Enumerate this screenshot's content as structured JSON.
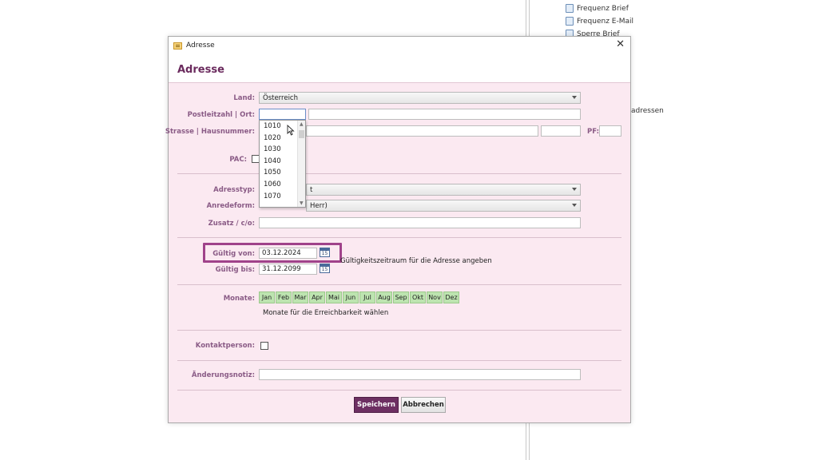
{
  "background": {
    "items": [
      "Frequenz Brief",
      "Frequenz E-Mail",
      "Sperre Brief"
    ],
    "side_text": "adressen"
  },
  "dialog": {
    "window_title": "Adresse",
    "close_glyph": "✕",
    "header_title": "Adresse"
  },
  "form": {
    "land_label": "Land:",
    "land_value": "Österreich",
    "plz_label": "Postleitzahl | Ort:",
    "plz_value": "",
    "ort_value": "",
    "strasse_label": "Strasse | Hausnummer:",
    "pf_label": "PF:",
    "pac_label": "PAC:",
    "adresstyp_label": "Adresstyp:",
    "adresstyp_value": "t",
    "anredeform_label": "Anredeform:",
    "anredeform_value": "Herr)",
    "zusatz_label": "Zusatz / c/o:",
    "gueltig_von_label": "Gültig von:",
    "gueltig_von_value": "03.12.2024",
    "gueltig_bis_label": "Gültig bis:",
    "gueltig_bis_value": "31.12.2099",
    "calendar_day": "15",
    "gueltig_note": "Gültigkeitszeitraum für die Adresse angeben",
    "monate_label": "Monate:",
    "months": [
      "Jan",
      "Feb",
      "Mar",
      "Apr",
      "Mai",
      "Jun",
      "Jul",
      "Aug",
      "Sep",
      "Okt",
      "Nov",
      "Dez"
    ],
    "monate_note": "Monate für die Erreichbarkeit wählen",
    "kontakt_label": "Kontaktperson:",
    "notiz_label": "Änderungsnotiz:"
  },
  "postcode_dropdown": [
    "1010",
    "1020",
    "1030",
    "1040",
    "1050",
    "1060",
    "1070"
  ],
  "buttons": {
    "save": "Speichern",
    "cancel": "Abbrechen"
  },
  "colors": {
    "accent": "#6d2f62",
    "dialog_bg": "#fbe9f1",
    "month_bg": "#bde4b0",
    "highlight": "#a0428a"
  }
}
